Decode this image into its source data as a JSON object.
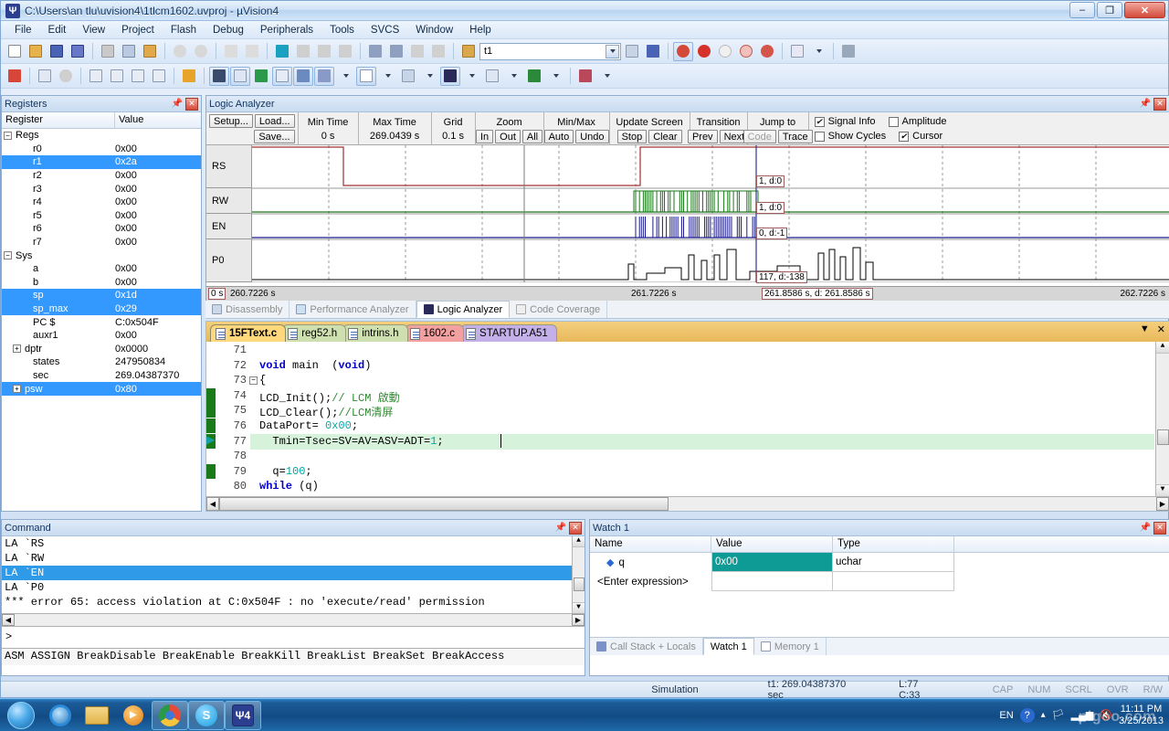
{
  "window": {
    "title": "C:\\Users\\an tlu\\uvision4\\1tlcm1602.uvproj - µVision4",
    "minimize": "–",
    "restore": "❐",
    "close": "✕"
  },
  "menu": [
    "File",
    "Edit",
    "View",
    "Project",
    "Flash",
    "Debug",
    "Peripherals",
    "Tools",
    "SVCS",
    "Window",
    "Help"
  ],
  "toolbar": {
    "target_combo": "t1"
  },
  "registers": {
    "panel_title": "Registers",
    "columns": [
      "Register",
      "Value"
    ],
    "rows": [
      {
        "name": "Regs",
        "value": "",
        "indent": 0,
        "node": "−",
        "selected": false
      },
      {
        "name": "r0",
        "value": "0x00",
        "indent": 1,
        "node": "",
        "selected": false
      },
      {
        "name": "r1",
        "value": "0x2a",
        "indent": 1,
        "node": "",
        "selected": true
      },
      {
        "name": "r2",
        "value": "0x00",
        "indent": 1,
        "node": "",
        "selected": false
      },
      {
        "name": "r3",
        "value": "0x00",
        "indent": 1,
        "node": "",
        "selected": false
      },
      {
        "name": "r4",
        "value": "0x00",
        "indent": 1,
        "node": "",
        "selected": false
      },
      {
        "name": "r5",
        "value": "0x00",
        "indent": 1,
        "node": "",
        "selected": false
      },
      {
        "name": "r6",
        "value": "0x00",
        "indent": 1,
        "node": "",
        "selected": false
      },
      {
        "name": "r7",
        "value": "0x00",
        "indent": 1,
        "node": "",
        "selected": false
      },
      {
        "name": "Sys",
        "value": "",
        "indent": 0,
        "node": "−",
        "selected": false
      },
      {
        "name": "a",
        "value": "0x00",
        "indent": 1,
        "node": "",
        "selected": false
      },
      {
        "name": "b",
        "value": "0x00",
        "indent": 1,
        "node": "",
        "selected": false
      },
      {
        "name": "sp",
        "value": "0x1d",
        "indent": 1,
        "node": "",
        "selected": true
      },
      {
        "name": "sp_max",
        "value": "0x29",
        "indent": 1,
        "node": "",
        "selected": true
      },
      {
        "name": "PC $",
        "value": "C:0x504F",
        "indent": 1,
        "node": "",
        "selected": false
      },
      {
        "name": "auxr1",
        "value": "0x00",
        "indent": 1,
        "node": "",
        "selected": false
      },
      {
        "name": "dptr",
        "value": "0x0000",
        "indent": 1,
        "node": "+",
        "selected": false
      },
      {
        "name": "states",
        "value": "247950834",
        "indent": 1,
        "node": "",
        "selected": false
      },
      {
        "name": "sec",
        "value": "269.04387370",
        "indent": 1,
        "node": "",
        "selected": false
      },
      {
        "name": "psw",
        "value": "0x80",
        "indent": 1,
        "node": "+",
        "selected": true
      }
    ]
  },
  "logic_analyzer": {
    "panel_title": "Logic Analyzer",
    "buttons": {
      "setup": "Setup...",
      "load": "Load...",
      "save": "Save..."
    },
    "min_time": {
      "label": "Min Time",
      "value": "0 s"
    },
    "max_time": {
      "label": "Max Time",
      "value": "269.0439 s"
    },
    "grid": {
      "label": "Grid",
      "value": "0.1 s"
    },
    "zoom": {
      "label": "Zoom",
      "in": "In",
      "out": "Out",
      "all": "All"
    },
    "minmax": {
      "label": "Min/Max",
      "auto": "Auto",
      "undo": "Undo"
    },
    "update_screen": {
      "label": "Update Screen",
      "stop": "Stop",
      "clear": "Clear"
    },
    "transition": {
      "label": "Transition",
      "prev": "Prev",
      "next": "Next"
    },
    "jump_to": {
      "label": "Jump to",
      "code": "Code",
      "trace": "Trace"
    },
    "checkboxes": [
      {
        "label": "Signal Info",
        "checked": true
      },
      {
        "label": "Amplitude",
        "checked": false
      },
      {
        "label": "Show Cycles",
        "checked": false
      },
      {
        "label": "Cursor",
        "checked": true
      }
    ],
    "signals": [
      {
        "name": "RS",
        "color": "#a03030",
        "annotation": "1, d:0"
      },
      {
        "name": "RW",
        "color": "#1a7a1a",
        "annotation": "1, d:0"
      },
      {
        "name": "EN",
        "color": "#1a1a8c",
        "annotation": "0, d:-1"
      },
      {
        "name": "P0",
        "color": "#000000",
        "annotation": "117, d:-138"
      }
    ],
    "time_axis": {
      "left": "0 s",
      "ticks": [
        "260.7226 s",
        "261.7226 s",
        "262.7226 s"
      ],
      "cursor": "261.8586 s, d: 261.8586 s"
    }
  },
  "view_tabs": [
    {
      "label": "Disassembly",
      "icon": "disassembly-icon",
      "active": false
    },
    {
      "label": "Performance Analyzer",
      "icon": "performance-icon",
      "active": false
    },
    {
      "label": "Logic Analyzer",
      "icon": "logic-analyzer-icon",
      "active": true
    },
    {
      "label": "Code Coverage",
      "icon": "code-coverage-icon",
      "active": false
    }
  ],
  "editor": {
    "tabs": [
      {
        "label": "15FText.c",
        "active": true,
        "color": "#ffd87e"
      },
      {
        "label": "reg52.h",
        "active": false,
        "color": "#cfe0b0"
      },
      {
        "label": "intrins.h",
        "active": false,
        "color": "#cfe0b0"
      },
      {
        "label": "1602.c",
        "active": false,
        "color": "#f2a0a0"
      },
      {
        "label": "STARTUP.A51",
        "active": false,
        "color": "#c4b0e8"
      }
    ],
    "lines": [
      {
        "num": "71",
        "text": "",
        "bookmark": false,
        "pc": false,
        "highlight": false
      },
      {
        "num": "72",
        "text": "void main  (void)",
        "bookmark": false,
        "pc": false,
        "highlight": false
      },
      {
        "num": "73",
        "text": "{",
        "bookmark": false,
        "pc": false,
        "highlight": false,
        "fold": "−"
      },
      {
        "num": "74",
        "text": "LCD_Init();// LCM 啟動",
        "bookmark": true,
        "pc": false,
        "highlight": false
      },
      {
        "num": "75",
        "text": "LCD_Clear();//LCM清屏",
        "bookmark": true,
        "pc": false,
        "highlight": false
      },
      {
        "num": "76",
        "text": "DataPort= 0x00;",
        "bookmark": true,
        "pc": false,
        "highlight": false
      },
      {
        "num": "77",
        "text": "  Tmin=Tsec=SV=AV=ASV=ADT=1;",
        "bookmark": true,
        "pc": true,
        "highlight": true
      },
      {
        "num": "78",
        "text": "",
        "bookmark": false,
        "pc": false,
        "highlight": false
      },
      {
        "num": "79",
        "text": "  q=100;",
        "bookmark": true,
        "pc": false,
        "highlight": false
      },
      {
        "num": "80",
        "text": "while (q)",
        "bookmark": false,
        "pc": false,
        "highlight": false
      }
    ],
    "collapse_btn": "▼",
    "close_btn": "✕"
  },
  "command": {
    "panel_title": "Command",
    "lines": [
      {
        "text": "LA `RS",
        "selected": false
      },
      {
        "text": "LA `RW",
        "selected": false
      },
      {
        "text": "LA `EN",
        "selected": true
      },
      {
        "text": "LA `P0",
        "selected": false
      },
      {
        "text": "*** error 65: access violation at C:0x504F : no 'execute/read' permission",
        "selected": false
      }
    ],
    "prompt": ">",
    "help_line": "ASM ASSIGN BreakDisable BreakEnable BreakKill BreakList BreakSet BreakAccess"
  },
  "watch": {
    "panel_title": "Watch 1",
    "columns": [
      "Name",
      "Value",
      "Type"
    ],
    "rows": [
      {
        "name": "q",
        "value": "0x00",
        "type": "uchar",
        "highlight": true
      },
      {
        "name": "<Enter expression>",
        "value": "",
        "type": "",
        "highlight": false
      }
    ],
    "tabs": [
      {
        "label": "Call Stack + Locals",
        "active": false
      },
      {
        "label": "Watch 1",
        "active": true
      },
      {
        "label": "Memory 1",
        "active": false
      }
    ]
  },
  "statusbar": {
    "mode": "Simulation",
    "time": "t1: 269.04387370 sec",
    "cursor": "L:77 C:33",
    "indicators": [
      "CAP",
      "NUM",
      "SCRL",
      "OVR",
      "R/W"
    ]
  },
  "taskbar": {
    "items": [
      "internet-explorer",
      "file-explorer",
      "media-player",
      "chrome",
      "skype",
      "uvision4"
    ],
    "language": "EN",
    "time": "11:11 PM",
    "date": "3/25/2013",
    "watermark": "pigoo.com"
  }
}
